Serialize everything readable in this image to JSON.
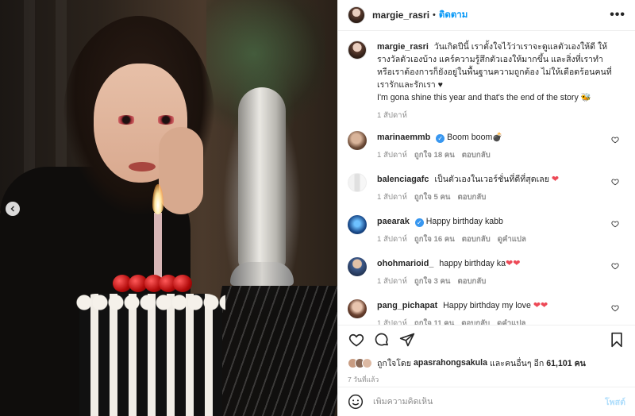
{
  "header": {
    "username": "margie_rasri",
    "separator": "•",
    "follow_label": "ติดตาม",
    "more_icon": "more-horizontal-icon"
  },
  "caption": {
    "username": "margie_rasri",
    "text": "วันเกิดปีนี้ เราตั้งใจไว้ว่าเราจะดูแลตัวเองให้ดี ให้รางวัลตัวเองบ้าง แคร์ความรู้สึกตัวเองให้มากขึ้น และสิ่งที่เราทำหรือเราต้องการก็ยังอยู่ในพื้นฐานความถูกต้อง ไม่ให้เดือดร้อนคนที่เรารักและรักเรา ♥",
    "text_en": "I'm gona shine this year and that's the end of the story 🐝",
    "time": "1 สัปดาห์"
  },
  "comments": [
    {
      "username": "marinaemmb",
      "verified": true,
      "text": "Boom boom💣",
      "time": "1 สัปดาห์",
      "likes": "ถูกใจ 18 คน",
      "reply": "ตอบกลับ",
      "translate": ""
    },
    {
      "username": "balenciagafc",
      "verified": false,
      "text": "เป็นตัวเองในเวอร์ชั่นที่ดีที่สุดเลย",
      "hearts": "❤",
      "time": "1 สัปดาห์",
      "likes": "ถูกใจ 5 คน",
      "reply": "ตอบกลับ",
      "translate": ""
    },
    {
      "username": "paearak",
      "verified": true,
      "text": "Happy birthday kabb",
      "time": "1 สัปดาห์",
      "likes": "ถูกใจ 16 คน",
      "reply": "ตอบกลับ",
      "translate": "ดูคำแปล"
    },
    {
      "username": "ohohmarioid_",
      "verified": false,
      "text": "happy birthday ka",
      "hearts": "❤❤",
      "time": "1 สัปดาห์",
      "likes": "ถูกใจ 3 คน",
      "reply": "ตอบกลับ",
      "translate": ""
    },
    {
      "username": "pang_pichapat",
      "verified": false,
      "text": "Happy birthday my love",
      "hearts": "❤❤",
      "time": "1 สัปดาห์",
      "likes": "ถูกใจ 11 คน",
      "reply": "ตอบกลับ",
      "translate": "ดูคำแปล"
    }
  ],
  "likes": {
    "prefix": "ถูกใจโดย",
    "user": "apasrahongsakula",
    "middle": "และคนอื่นๆ อีก",
    "count": "61,101 คน"
  },
  "post_time": "7 วันที่แล้ว",
  "add_comment": {
    "placeholder": "เพิ่มความคิดเห็น",
    "post_label": "โพสต์"
  },
  "colors": {
    "accent": "#0095f6",
    "verified": "#3897f0",
    "heart": "#ed4956",
    "post_disabled": "#b2dffc",
    "muted": "#8e8e8e"
  }
}
